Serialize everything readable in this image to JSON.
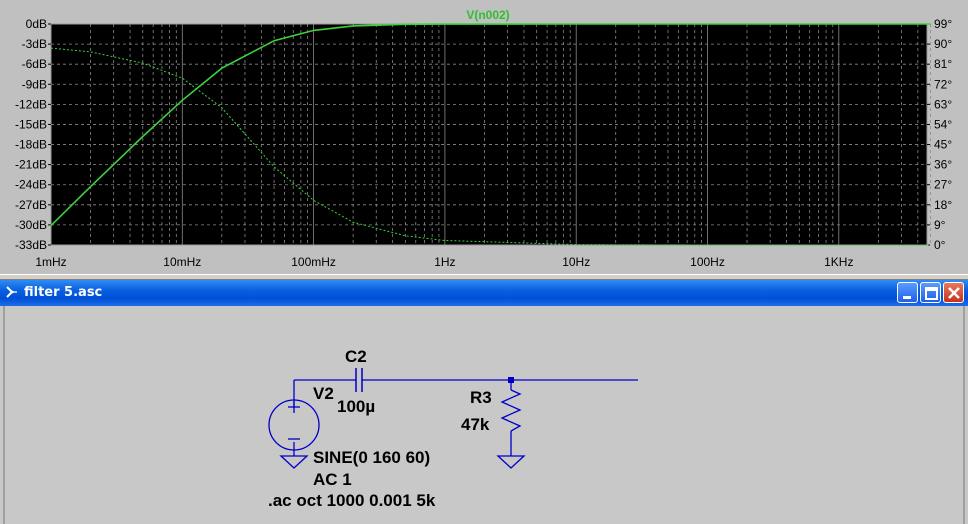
{
  "plot": {
    "trace_name": "V(n002)",
    "left_axis_ticks": [
      "0dB",
      "-3dB",
      "-6dB",
      "-9dB",
      "-12dB",
      "-15dB",
      "-18dB",
      "-21dB",
      "-24dB",
      "-27dB",
      "-30dB",
      "-33dB"
    ],
    "right_axis_ticks": [
      "99°",
      "90°",
      "81°",
      "72°",
      "63°",
      "54°",
      "45°",
      "36°",
      "27°",
      "18°",
      "9°",
      "0°"
    ],
    "x_axis_ticks": [
      "1mHz",
      "10mHz",
      "100mHz",
      "1Hz",
      "10Hz",
      "100Hz",
      "1KHz"
    ],
    "colors": {
      "background": "#000000",
      "grid": "#8a8a8a",
      "trace": "#3cd23c",
      "label": "#2fbf2f"
    }
  },
  "chart_data": {
    "type": "line",
    "xscale": "log",
    "x_range_hz": [
      0.001,
      5000
    ],
    "y_left_range_db": [
      -33,
      0
    ],
    "y_right_range_deg": [
      0,
      99
    ],
    "series": [
      {
        "name": "V(n002)",
        "style": "solid",
        "axis": "left",
        "x": [
          0.001,
          0.002,
          0.005,
          0.01,
          0.02,
          0.05,
          0.1,
          0.2,
          0.5,
          1,
          10,
          100,
          1000,
          5000
        ],
        "y": [
          -30.1,
          -24.3,
          -16.8,
          -11.4,
          -6.6,
          -2.5,
          -0.96,
          -0.28,
          -0.05,
          -0.01,
          0,
          0,
          0,
          0
        ]
      },
      {
        "name": "phase",
        "style": "dotted",
        "axis": "right",
        "x": [
          0.001,
          0.002,
          0.005,
          0.01,
          0.02,
          0.05,
          0.1,
          0.2,
          0.5,
          1,
          10,
          100,
          1000,
          5000
        ],
        "y": [
          88.2,
          86.5,
          81.5,
          74.7,
          61.5,
          35.0,
          20.0,
          10.2,
          4.1,
          2.0,
          0.2,
          0,
          0,
          0
        ]
      }
    ]
  },
  "window": {
    "title": "filter 5.asc"
  },
  "schematic": {
    "labels": {
      "c2_name": "C2",
      "c2_value": "100µ",
      "v2_name": "V2",
      "r3_name": "R3",
      "r3_value": "47k",
      "sine": "SINE(0 160 60)",
      "ac": "AC 1",
      "directive": ".ac oct 1000 0.001 5k"
    },
    "colors": {
      "wire": "#0000c8",
      "component": "#0000c8"
    }
  }
}
